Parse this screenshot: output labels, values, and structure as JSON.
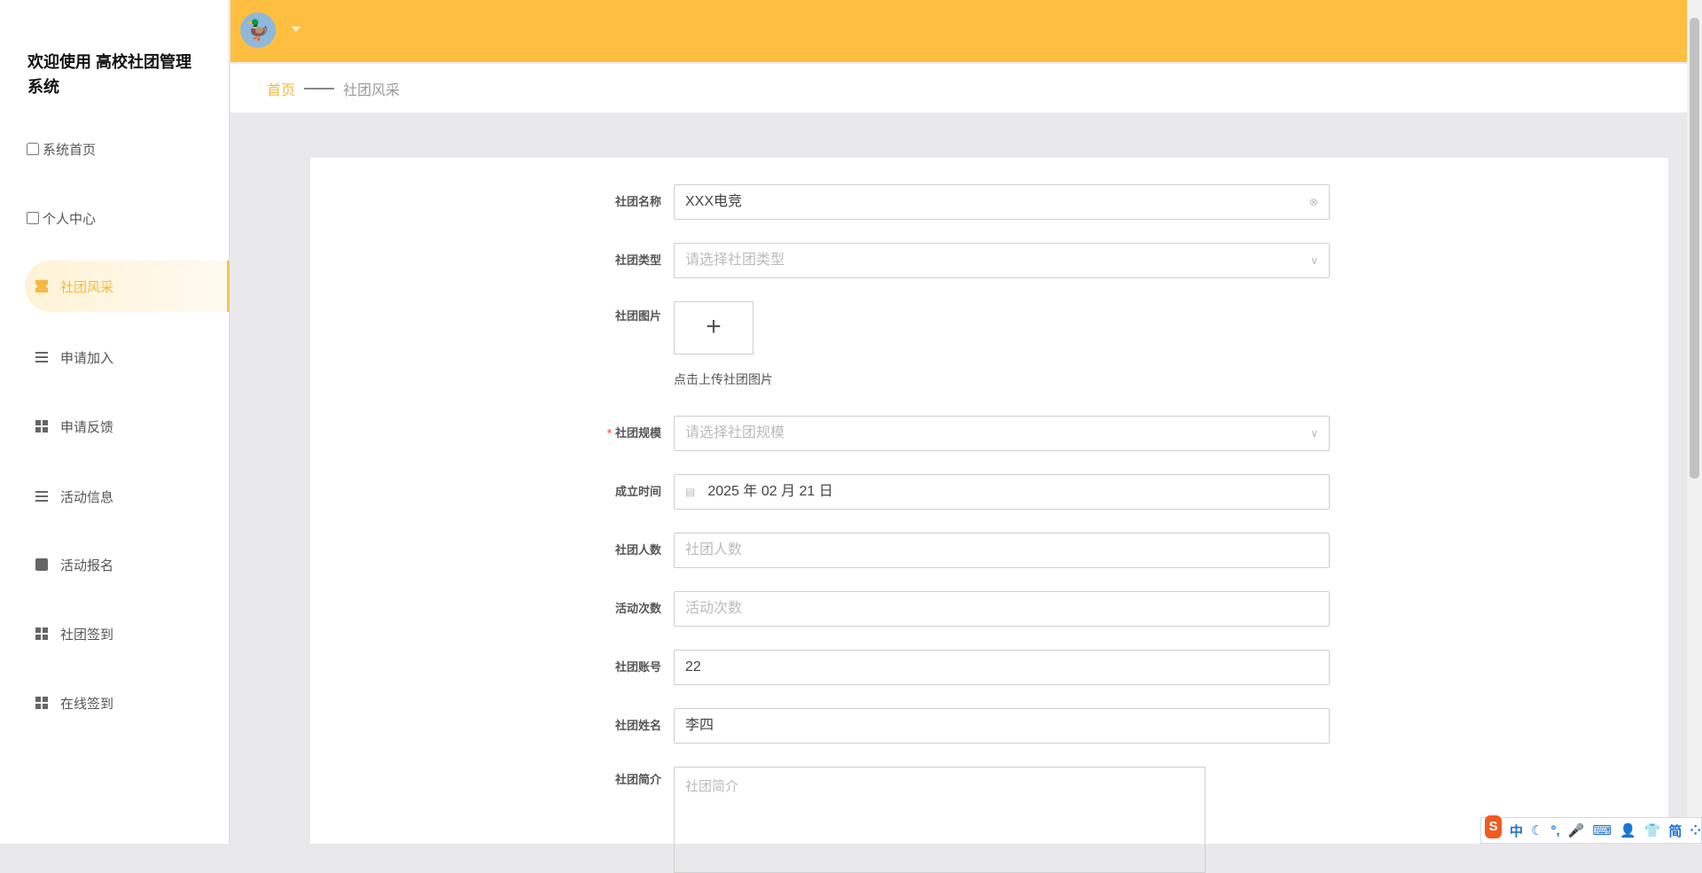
{
  "sidebar": {
    "title": "欢迎使用 高校社团管理系统",
    "items": [
      {
        "label": "系统首页",
        "icon": "home-icon"
      },
      {
        "label": "个人中心",
        "icon": "wallet-icon"
      },
      {
        "label": "社团风采",
        "icon": "ticket-icon",
        "active": true
      },
      {
        "label": "申请加入",
        "icon": "list-icon"
      },
      {
        "label": "申请反馈",
        "icon": "grid-icon"
      },
      {
        "label": "活动信息",
        "icon": "list-icon"
      },
      {
        "label": "活动报名",
        "icon": "clipboard-icon"
      },
      {
        "label": "社团签到",
        "icon": "grid-icon"
      },
      {
        "label": "在线签到",
        "icon": "grid-icon"
      }
    ]
  },
  "header": {
    "avatar": "🦆",
    "accent": "#febf41"
  },
  "breadcrumb": {
    "home": "首页",
    "current": "社团风采"
  },
  "form": {
    "name": {
      "label": "社团名称",
      "value": "XXX电竞"
    },
    "type": {
      "label": "社团类型",
      "placeholder": "请选择社团类型"
    },
    "image": {
      "label": "社团图片",
      "plus": "+",
      "hint": "点击上传社团图片"
    },
    "scale": {
      "label": "社团规模",
      "required": "*",
      "placeholder": "请选择社团规模"
    },
    "founded": {
      "label": "成立时间",
      "value": "2025 年 02 月 21 日"
    },
    "members": {
      "label": "社团人数",
      "placeholder": "社团人数"
    },
    "activities": {
      "label": "活动次数",
      "placeholder": "活动次数"
    },
    "account": {
      "label": "社团账号",
      "value": "22"
    },
    "owner": {
      "label": "社团姓名",
      "value": "李四"
    },
    "intro": {
      "label": "社团简介",
      "placeholder": "社团简介"
    }
  },
  "ime": {
    "logo": "S",
    "items": [
      "中",
      "☾",
      "°,",
      "🎤",
      "⌨",
      "👤",
      "👕",
      "简",
      "⁘"
    ]
  }
}
